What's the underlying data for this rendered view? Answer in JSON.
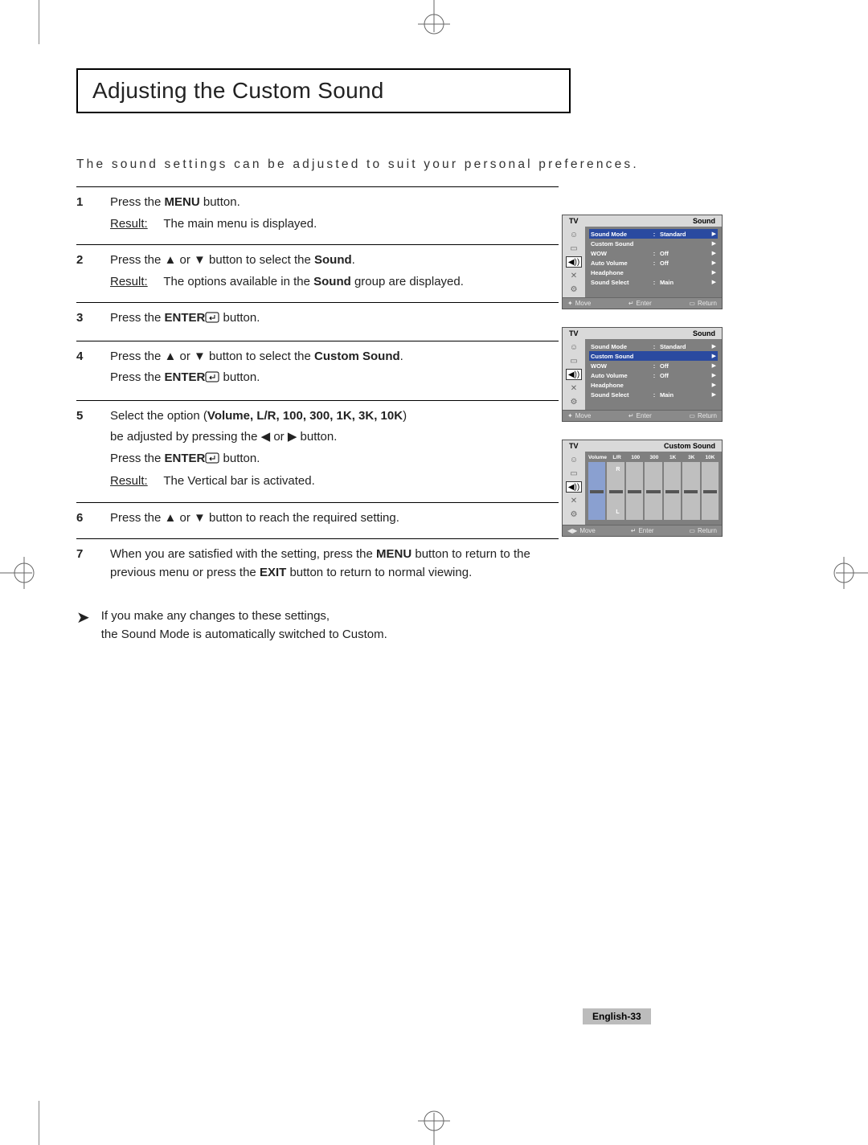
{
  "title": "Adjusting the Custom Sound",
  "intro": "The sound settings can be adjusted to suit your personal preferences.",
  "steps": [
    {
      "num": "1",
      "line1_pre": "Press the ",
      "line1_bold": "MENU",
      "line1_post": " button.",
      "result": "The main menu is displayed."
    },
    {
      "num": "2",
      "line1_pre": "Press the ▲ or ▼ button to select the ",
      "line1_bold": "Sound",
      "line1_post": ".",
      "result_pre": "The options available in the ",
      "result_bold": "Sound",
      "result_post": " group are displayed."
    },
    {
      "num": "3",
      "line1_pre": "Press the ",
      "line1_bold": "ENTER",
      "line1_post": " button."
    },
    {
      "num": "4",
      "line1_pre": "Press the ▲ or ▼ button to select the ",
      "line1_bold": "Custom Sound",
      "line1_post": ".",
      "line2_pre": "Press the ",
      "line2_bold": "ENTER",
      "line2_post": " button."
    },
    {
      "num": "5",
      "line1_pre": "Select the option (",
      "line1_bold": "Volume, L/R, 100, 300,  1K,  3K,  10K",
      "line1_post": ")",
      "line2": "be adjusted by pressing the ◀ or ▶ button.",
      "line3_pre": "Press the ",
      "line3_bold": "ENTER",
      "line3_post": " button.",
      "result": "The Vertical bar is activated."
    },
    {
      "num": "6",
      "line1": "Press the ▲ or ▼ button to reach the required setting."
    },
    {
      "num": "7",
      "line1_pre": "When you are satisfied with the setting, press the ",
      "line1_bold": "MENU",
      "line1_post": " button",
      "line2_pre": "to return to the previous menu or press the ",
      "line2_bold": "EXIT",
      "line2_post": " button to return to normal viewing."
    }
  ],
  "note_line1": "If you make any changes to these settings,",
  "note_line2": "the Sound Mode is automatically switched to Custom.",
  "result_label": "Result:",
  "osd": {
    "tv": "TV",
    "sound": "Sound",
    "custom_sound": "Custom Sound",
    "rows": [
      {
        "label": "Sound Mode",
        "colon": ":",
        "value": "Standard"
      },
      {
        "label": "Custom Sound",
        "colon": "",
        "value": ""
      },
      {
        "label": "WOW",
        "colon": ":",
        "value": "Off"
      },
      {
        "label": "Auto Volume",
        "colon": ":",
        "value": "Off"
      },
      {
        "label": "Headphone",
        "colon": "",
        "value": ""
      },
      {
        "label": "Sound Select",
        "colon": ":",
        "value": "Main"
      }
    ],
    "footer": {
      "move": "Move",
      "enter": "Enter",
      "return": "Return"
    },
    "eq_bands": [
      "Volume",
      "L/R",
      "100",
      "300",
      "1K",
      "3K",
      "10K"
    ],
    "eq_R": "R",
    "eq_L": "L"
  },
  "footer_glyphs": {
    "move": "✦",
    "enter": "↵",
    "return": "▭"
  },
  "page_number": "English-33"
}
